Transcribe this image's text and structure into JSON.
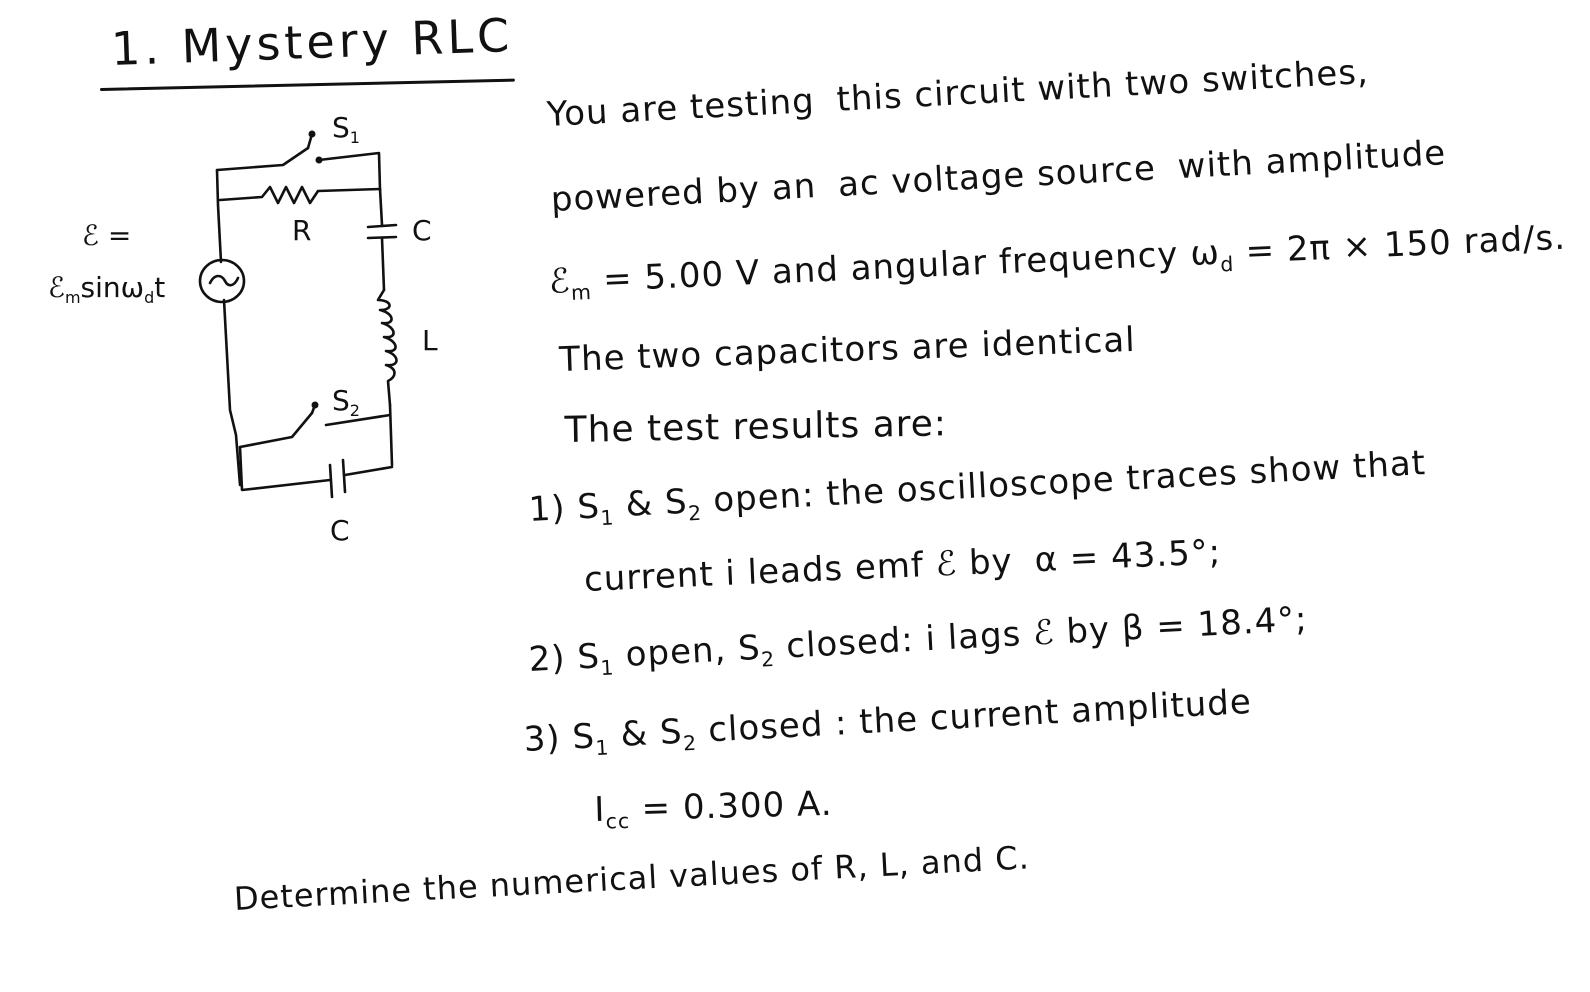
{
  "title": "1. Mystery RLC",
  "circuit": {
    "labels": {
      "switch1": "S",
      "switch1_sub": "1",
      "switch2": "S",
      "switch2_sub": "2",
      "resistor": "R",
      "capacitor_top": "C",
      "inductor": "L",
      "capacitor_bottom": "C",
      "emf_lhs": "ℰ =",
      "emf_rhs": "ℰ",
      "emf_rhs_sub": "m",
      "emf_rhs_rest": "sinω",
      "emf_rhs_sub2": "d",
      "emf_rhs_t": "t",
      "source_symbol": "~"
    },
    "icons": [
      "ac-source-icon",
      "resistor-icon",
      "capacitor-icon",
      "inductor-icon",
      "switch-icon"
    ]
  },
  "problem": {
    "lines": [
      {
        "parts": [
          "You are testing",
          "this circuit with two switches,"
        ]
      },
      {
        "parts": [
          "powered by an",
          "ac voltage source",
          "with amplitude"
        ]
      },
      {
        "parts": [
          "ℰ",
          "m",
          " = 5.00 V and angular frequency",
          "ω",
          "d",
          " = 2π × 150 rad/s."
        ]
      },
      {
        "parts": [
          "The two capacitors are identical"
        ]
      },
      {
        "parts": [
          "The test results are:"
        ]
      },
      {
        "parts": [
          "1) S",
          "1",
          " & S",
          "2",
          " open: the oscilloscope traces show that"
        ]
      },
      {
        "parts": [
          "current i leads emf ℰ by",
          "α = 43.5°;"
        ]
      },
      {
        "parts": [
          "2) S",
          "1",
          " open, S",
          "2",
          " closed: i lags ℰ by β = 18.4°;"
        ]
      },
      {
        "parts": [
          "3) S",
          "1",
          " & S",
          "2",
          " closed : the current amplitude"
        ]
      },
      {
        "parts": [
          "I",
          "cc",
          " = 0.300 A."
        ]
      },
      {
        "parts": [
          "Determine the numerical values of R, L, and C."
        ]
      }
    ],
    "values": {
      "emf_amplitude": "5.00 V",
      "angular_frequency": "2π × 150 rad/s",
      "alpha": "43.5°",
      "beta": "18.4°",
      "current_amplitude": "0.300 A"
    }
  }
}
